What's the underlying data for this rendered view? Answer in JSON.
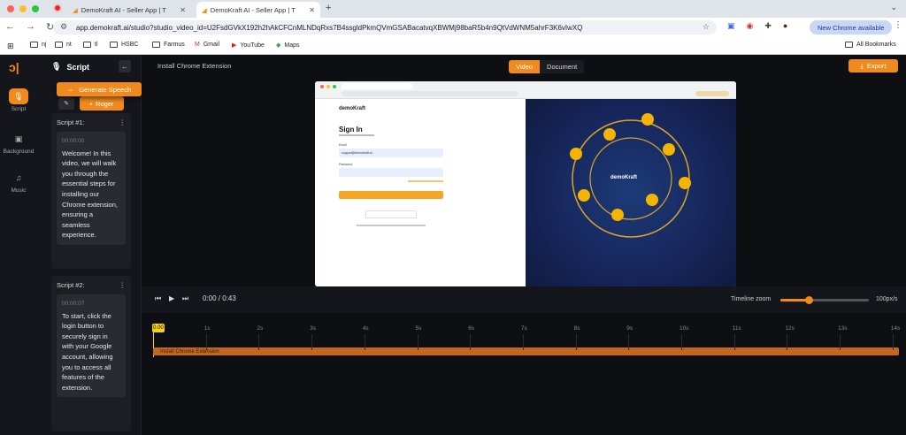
{
  "browser": {
    "tabs": [
      {
        "title": "DemoKraft AI - Seller App | T",
        "active": false
      },
      {
        "title": "DemoKraft AI - Seller App | T",
        "active": true
      }
    ],
    "url": "app.demokraft.ai/studio?studio_video_id=U2FsdGVkX192h2hAkCFCnMLNDqRxs7B4ssgldPkmQVmGSABacatvqXBWMj98baR5b4n9QtVdWNM5ahrF3K6vIwXQ",
    "new_chrome_label": "New Chrome available",
    "bookmarks": [
      "nj",
      "nt",
      "tl",
      "HSBC",
      "Farmus",
      "Gmail",
      "YouTube",
      "Maps"
    ],
    "all_bookmarks_label": "All Bookmarks"
  },
  "rail": {
    "items": [
      {
        "label": "Script",
        "icon": "mic-icon",
        "active": true
      },
      {
        "label": "Background",
        "icon": "image-icon",
        "active": false
      },
      {
        "label": "Music",
        "icon": "music-icon",
        "active": false
      }
    ]
  },
  "script_panel": {
    "title": "Script",
    "generate_label": "Generate Speech",
    "voice_label": "Roger",
    "scripts": [
      {
        "title": "Script #1:",
        "timestamp": "00:00:00",
        "text": "Welcome! In this video, we will walk you through the essential steps for installing our Chrome extension, ensuring a seamless experience."
      },
      {
        "title": "Script #2:",
        "timestamp": "00:00:07",
        "text": "To start, click the login button to securely sign in with your Google account, allowing you to access all features of the extension."
      }
    ]
  },
  "header": {
    "project_title": "Install Chrome Extension",
    "view_tabs": [
      {
        "label": "Video",
        "active": true
      },
      {
        "label": "Document",
        "active": false
      }
    ],
    "export_label": "Export"
  },
  "preview": {
    "brand": "demoKraft",
    "signin_title": "Sign In",
    "email_label": "Email",
    "email_value": "support@demokraft.ai",
    "password_label": "Password",
    "right_brand": "demoKraft"
  },
  "player": {
    "time": "0:00 / 0:43",
    "zoom_label": "Timeline zoom",
    "zoom_value": "100px/s",
    "zoom_fraction": 0.32
  },
  "timeline": {
    "playhead_label": "0.00",
    "ticks": [
      "1s",
      "2s",
      "3s",
      "4s",
      "5s",
      "6s",
      "7s",
      "8s",
      "9s",
      "10s",
      "11s",
      "12s",
      "13s",
      "14s"
    ],
    "clip_label": "Install Chrome Extension"
  },
  "colors": {
    "accent": "#f08a1c",
    "playhead": "#f3d21c",
    "clip": "#c3671c"
  }
}
